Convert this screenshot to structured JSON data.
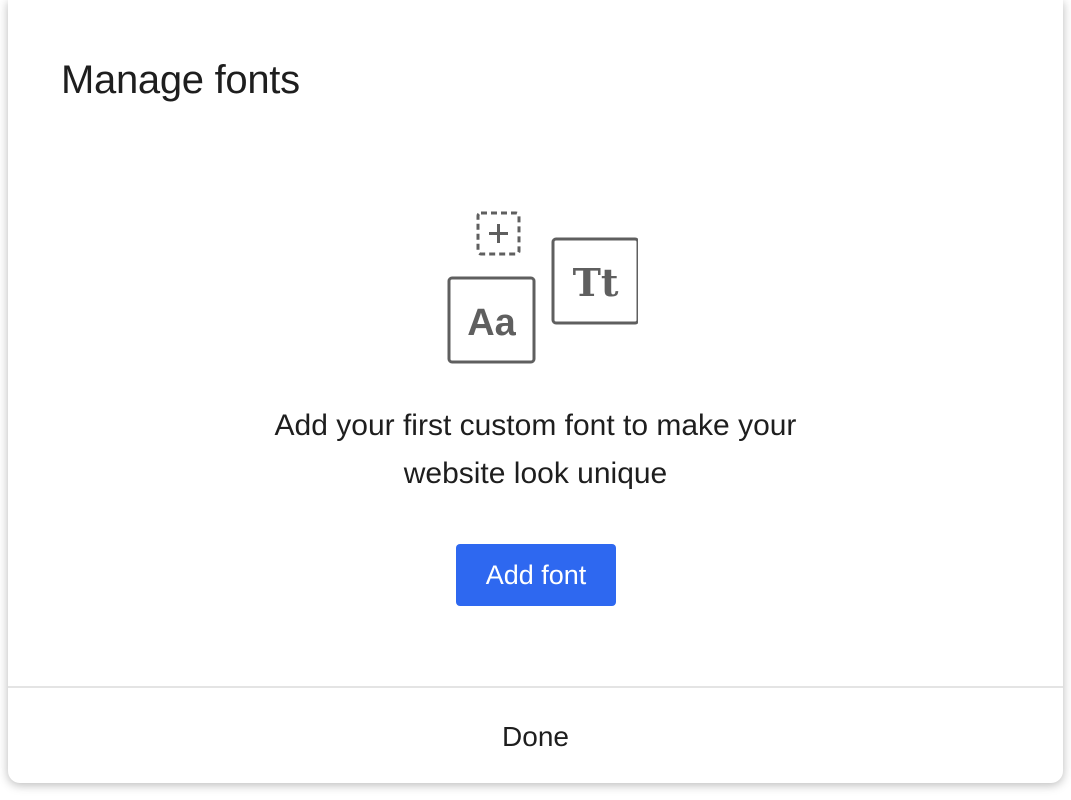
{
  "dialog": {
    "title": "Manage fonts",
    "illustration": {
      "sample_a": "Aa",
      "sample_b": "Tt",
      "icon": "dashed-plus-icon"
    },
    "message_line1": "Add your first custom font to make your",
    "message_line2": "website look unique",
    "add_button_label": "Add font",
    "done_button_label": "Done"
  },
  "colors": {
    "accent": "#2e68f0",
    "text": "#1e1e1e",
    "icon_stroke": "#5f5f5f",
    "divider": "#e4e4e4"
  }
}
